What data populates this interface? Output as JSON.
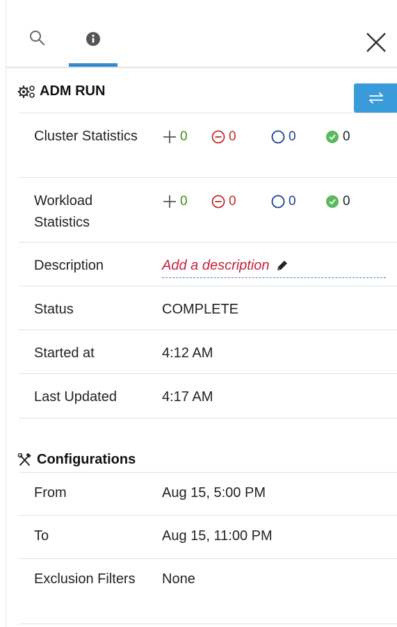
{
  "header": {
    "tabs": [
      {
        "icon": "search-icon"
      },
      {
        "icon": "info-icon"
      }
    ],
    "close_icon": "close-icon",
    "accent_color": "#2f8ad1"
  },
  "adm_run": {
    "title": "ADM RUN",
    "title_icon": "gears-icon",
    "swap_icon": "swap-arrows-icon",
    "rows": {
      "cluster_statistics": {
        "label": "Cluster Statistics",
        "added": "0",
        "removed": "0",
        "unchanged": "0",
        "approved": "0"
      },
      "workload_statistics": {
        "label": "Workload Statistics",
        "added": "0",
        "removed": "0",
        "unchanged": "0",
        "approved": "0"
      },
      "description": {
        "label": "Description",
        "value": "Add a description",
        "icon": "pencil-icon"
      },
      "status": {
        "label": "Status",
        "value": "COMPLETE"
      },
      "started_at": {
        "label": "Started at",
        "value": "4:12 AM"
      },
      "last_updated": {
        "label": "Last Updated",
        "value": "4:17 AM"
      }
    }
  },
  "configurations": {
    "title": "Configurations",
    "title_icon": "tools-icon",
    "rows": {
      "from": {
        "label": "From",
        "value": "Aug 15, 5:00 PM"
      },
      "to": {
        "label": "To",
        "value": "Aug 15, 11:00 PM"
      },
      "exclusion_filters": {
        "label": "Exclusion Filters",
        "value": "None"
      }
    }
  },
  "colors": {
    "added": "#3a8f1d",
    "removed": "#c62828",
    "unchanged": "#1b3f8f",
    "approved": "#5cb85c",
    "swap_button": "#3a9bdb",
    "description_link": "#c2223f"
  }
}
